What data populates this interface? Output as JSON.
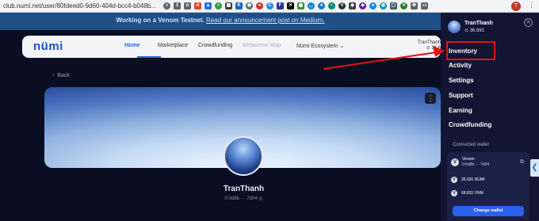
{
  "browser": {
    "url": "club.numi.net/user/80fdeed0-9d60-404d-bcc4-b048b...",
    "profile_initial": "T",
    "menu_icon": "⋮",
    "extensions": [
      {
        "name": "zoom-icon",
        "glyph": "⌕",
        "color": "#5f6368",
        "shape": "round"
      },
      {
        "name": "share-icon",
        "glyph": "⇪",
        "color": "#5f6368",
        "shape": "square"
      },
      {
        "name": "star-icon",
        "glyph": "☆",
        "color": "#5f6368",
        "shape": "square"
      },
      {
        "name": "acrobat-extension-icon",
        "glyph": "A",
        "color": "#e2432a",
        "shape": "square"
      },
      {
        "name": "drive-extension-icon",
        "glyph": "▲",
        "color": "#1a73e8",
        "shape": "square"
      },
      {
        "name": "green-extension-icon",
        "glyph": "•",
        "color": "#2e9e4a",
        "shape": "round"
      },
      {
        "name": "grid-extension-icon",
        "glyph": "▦",
        "color": "#3c4043",
        "shape": "square"
      },
      {
        "name": "k-extension-icon",
        "glyph": "K",
        "color": "#1565c0",
        "shape": "square"
      },
      {
        "name": "eye-extension-icon",
        "glyph": "◉",
        "color": "#546e7a",
        "shape": "round"
      },
      {
        "name": "red-extension-icon",
        "glyph": "●",
        "color": "#d32f2f",
        "shape": "round"
      },
      {
        "name": "c-extension-icon",
        "glyph": "C",
        "color": "#1e88e5",
        "shape": "round"
      },
      {
        "name": "f-extension-icon",
        "glyph": "F",
        "color": "#283593",
        "shape": "square"
      },
      {
        "name": "x-extension-icon",
        "glyph": "✕",
        "color": "#000000",
        "shape": "square"
      },
      {
        "name": "image-extension-icon",
        "glyph": "▣",
        "color": "#388e3c",
        "shape": "square"
      },
      {
        "name": "wifi-extension-icon",
        "glyph": "◡",
        "color": "#0288d1",
        "shape": "round"
      },
      {
        "name": "blue-extension-icon",
        "glyph": "●",
        "color": "#1976d2",
        "shape": "round"
      },
      {
        "name": "teal-extension-icon",
        "glyph": "◐",
        "color": "#00897b",
        "shape": "round"
      },
      {
        "name": "venom-extension-icon",
        "glyph": "V",
        "color": "#263238",
        "shape": "round"
      },
      {
        "name": "diamond-extension-icon",
        "glyph": "◆",
        "color": "#424242",
        "shape": "square"
      },
      {
        "name": "shield-extension-icon",
        "glyph": "◈",
        "color": "#6a1b9a",
        "shape": "round"
      },
      {
        "name": "blue2-extension-icon",
        "glyph": "●",
        "color": "#1e88e5",
        "shape": "round"
      },
      {
        "name": "drop-extension-icon",
        "glyph": "◍",
        "color": "#0097a7",
        "shape": "round"
      },
      {
        "name": "frame-extension-icon",
        "glyph": "▢",
        "color": "#455a64",
        "shape": "square"
      },
      {
        "name": "v-extension-icon",
        "glyph": "V",
        "color": "#2e7d32",
        "shape": "round"
      },
      {
        "name": "puzzle-icon",
        "glyph": "✤",
        "color": "#5f6368",
        "shape": "square"
      },
      {
        "name": "tab-icon",
        "glyph": "▭",
        "color": "#5f6368",
        "shape": "square"
      }
    ]
  },
  "banner": {
    "text_before": "Working on a Venom Testnet. ",
    "link": "Read our announcement post on Medium."
  },
  "navbar": {
    "logo": "nümi",
    "links": [
      {
        "label": "Home",
        "active": true
      },
      {
        "label": "Marketplace",
        "active": false
      },
      {
        "label": "Crowdfunding",
        "active": false
      },
      {
        "label": "Metaverse Map",
        "active": false,
        "dim": true
      },
      {
        "label": "Nümi Ecosystem ⌄",
        "active": false
      }
    ],
    "user_name": "TranThanh",
    "user_balance": "⊙ 36.6"
  },
  "page": {
    "back_label": "Back",
    "back_icon": "‹",
    "menu_icon": "⋮",
    "profile_name": "TranThanh",
    "profile_address": "0:0d8b ··· 7d04  ◎"
  },
  "panel": {
    "username": "TranThanh",
    "balance": "⊙ 36.691",
    "close_icon": "✕",
    "menu": [
      "Inventory",
      "Activity",
      "Settings",
      "Support",
      "Earning",
      "Crowdfunding"
    ],
    "connected_label": "Connected wallet",
    "wallet_name": "Venom",
    "wallet_address": "0:0d8b ··· 7d04",
    "wallet_copy_icon": "⧉",
    "token1": "36.691 NÜMI",
    "token2": "68.831 VNM",
    "token_icon": "V",
    "change_button": "Change wallet",
    "collapse_icon": "❮"
  },
  "annotation": {
    "highlight_color": "#e01414"
  }
}
